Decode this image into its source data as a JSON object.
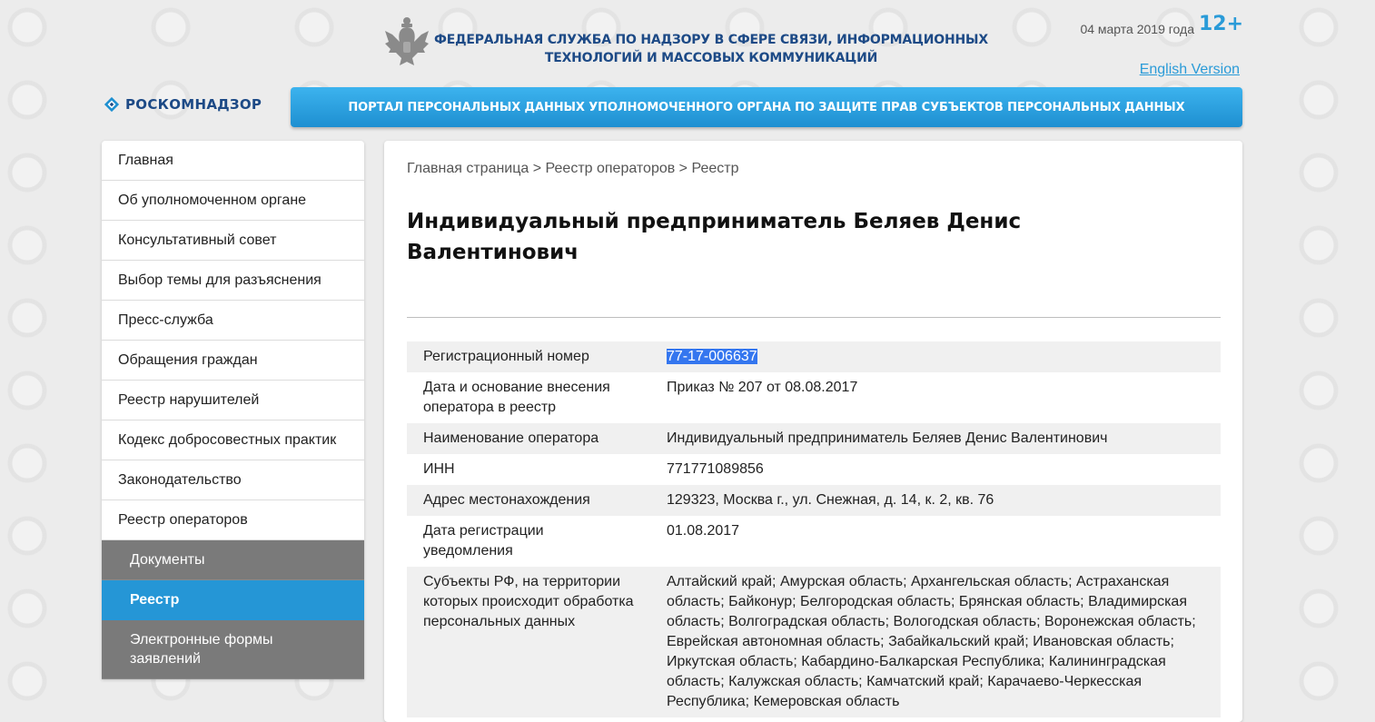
{
  "header": {
    "agency_title": "ФЕДЕРАЛЬНАЯ СЛУЖБА ПО НАДЗОРУ В СФЕРЕ СВЯЗИ, ИНФОРМАЦИОННЫХ ТЕХНОЛОГИЙ И МАССОВЫХ КОММУНИКАЦИЙ",
    "date": "04 марта 2019 года",
    "age_rating": "12+",
    "english_link": "English Version",
    "logo_text": "РОСКОМНАДЗОР",
    "portal_banner": "ПОРТАЛ ПЕРСОНАЛЬНЫХ ДАННЫХ УПОЛНОМОЧЕННОГО ОРГАНА ПО ЗАЩИТЕ ПРАВ СУБЪЕКТОВ ПЕРСОНАЛЬНЫХ ДАННЫХ"
  },
  "colors": {
    "brand_blue": "#1d4a86",
    "accent_blue": "#2596d6",
    "submenu_gray": "#7a7a7a"
  },
  "sidebar": {
    "items": [
      {
        "label": "Главная"
      },
      {
        "label": "Об уполномоченном органе"
      },
      {
        "label": "Консультативный совет"
      },
      {
        "label": "Выбор темы для разъяснения"
      },
      {
        "label": "Пресс-служба"
      },
      {
        "label": "Обращения граждан"
      },
      {
        "label": "Реестр нарушителей"
      },
      {
        "label": "Кодекс добросовестных практик"
      },
      {
        "label": "Законодательство"
      },
      {
        "label": "Реестр операторов"
      }
    ],
    "subitems": [
      {
        "label": "Документы"
      },
      {
        "label": "Реестр"
      },
      {
        "label": "Электронные формы заявлений"
      }
    ]
  },
  "main": {
    "breadcrumb": {
      "home": "Главная страница",
      "registry_of_operators": "Реестр операторов",
      "registry": "Реестр",
      "separator": " > "
    },
    "title": "Индивидуальный предприниматель Беляев Денис Валентинович",
    "details": [
      {
        "label": "Регистрационный номер",
        "value": "77-17-006637"
      },
      {
        "label": "Дата и основание внесения оператора в реестр",
        "value": "Приказ № 207 от 08.08.2017"
      },
      {
        "label": "Наименование оператора",
        "value": "Индивидуальный предприниматель Беляев Денис Валентинович"
      },
      {
        "label": "ИНН",
        "value": "771771089856"
      },
      {
        "label": "Адрес местонахождения",
        "value": "129323, Москва г., ул. Снежная, д. 14, к. 2, кв. 76"
      },
      {
        "label": "Дата регистрации уведомления",
        "value": "01.08.2017"
      },
      {
        "label": "Субъекты РФ, на территории которых происходит обработка персональных данных",
        "value": "Алтайский край; Амурская область; Архангельская область; Астраханская область; Байконур; Белгородская область; Брянская область; Владимирская область; Волгоградская область; Вологодская область; Воронежская область; Еврейская автономная область; Забайкальский край; Ивановская область; Иркутская область; Кабардино-Балкарская Республика; Калининградская область; Калужская область; Камчатский край; Карачаево-Черкесская Республика; Кемеровская область"
      }
    ]
  }
}
